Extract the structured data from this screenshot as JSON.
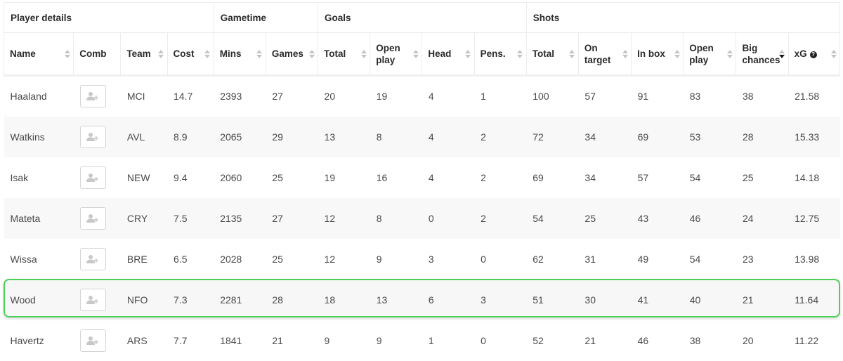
{
  "groups": [
    {
      "label": "Player details",
      "span": 4
    },
    {
      "label": "Gametime",
      "span": 2
    },
    {
      "label": "Goals",
      "span": 4
    },
    {
      "label": "Shots",
      "span": 6
    }
  ],
  "columns": [
    {
      "label": "Name",
      "sortable": true
    },
    {
      "label": "Comb",
      "sortable": false
    },
    {
      "label": "Team",
      "sortable": true
    },
    {
      "label": "Cost",
      "sortable": true
    },
    {
      "label": "Mins",
      "sortable": true
    },
    {
      "label": "Games",
      "sortable": true
    },
    {
      "label": "Total",
      "sortable": true
    },
    {
      "label": "Open play",
      "sortable": true
    },
    {
      "label": "Head",
      "sortable": true
    },
    {
      "label": "Pens.",
      "sortable": true
    },
    {
      "label": "Total",
      "sortable": true
    },
    {
      "label": "On target",
      "sortable": true
    },
    {
      "label": "In box",
      "sortable": true
    },
    {
      "label": "Open play",
      "sortable": true
    },
    {
      "label": "Big chances",
      "sortable": true,
      "sorted": "desc"
    },
    {
      "label": "xG",
      "sortable": true,
      "help_icon": "question-circle-icon"
    }
  ],
  "comb_icon": "add-user-icon",
  "highlight_color": "#4cd05a",
  "highlighted_row": "Wood",
  "rows": [
    {
      "name": "Haaland",
      "team": "MCI",
      "cost": "14.7",
      "mins": "2393",
      "games": "27",
      "goals_total": "20",
      "goals_open": "19",
      "head": "4",
      "pens": "1",
      "shots_total": "100",
      "on_target": "57",
      "in_box": "91",
      "shots_open": "83",
      "big_chances": "38",
      "xg": "21.58"
    },
    {
      "name": "Watkins",
      "team": "AVL",
      "cost": "8.9",
      "mins": "2065",
      "games": "29",
      "goals_total": "13",
      "goals_open": "8",
      "head": "4",
      "pens": "2",
      "shots_total": "72",
      "on_target": "34",
      "in_box": "69",
      "shots_open": "53",
      "big_chances": "28",
      "xg": "15.33"
    },
    {
      "name": "Isak",
      "team": "NEW",
      "cost": "9.4",
      "mins": "2060",
      "games": "25",
      "goals_total": "19",
      "goals_open": "16",
      "head": "4",
      "pens": "2",
      "shots_total": "69",
      "on_target": "34",
      "in_box": "57",
      "shots_open": "54",
      "big_chances": "25",
      "xg": "14.18"
    },
    {
      "name": "Mateta",
      "team": "CRY",
      "cost": "7.5",
      "mins": "2135",
      "games": "27",
      "goals_total": "12",
      "goals_open": "8",
      "head": "0",
      "pens": "2",
      "shots_total": "54",
      "on_target": "25",
      "in_box": "43",
      "shots_open": "46",
      "big_chances": "24",
      "xg": "12.75"
    },
    {
      "name": "Wissa",
      "team": "BRE",
      "cost": "6.5",
      "mins": "2028",
      "games": "25",
      "goals_total": "12",
      "goals_open": "9",
      "head": "3",
      "pens": "0",
      "shots_total": "62",
      "on_target": "31",
      "in_box": "49",
      "shots_open": "54",
      "big_chances": "23",
      "xg": "13.98"
    },
    {
      "name": "Wood",
      "team": "NFO",
      "cost": "7.3",
      "mins": "2281",
      "games": "28",
      "goals_total": "18",
      "goals_open": "13",
      "head": "6",
      "pens": "3",
      "shots_total": "51",
      "on_target": "30",
      "in_box": "41",
      "shots_open": "40",
      "big_chances": "21",
      "xg": "11.64"
    },
    {
      "name": "Havertz",
      "team": "ARS",
      "cost": "7.7",
      "mins": "1841",
      "games": "21",
      "goals_total": "9",
      "goals_open": "9",
      "head": "1",
      "pens": "0",
      "shots_total": "52",
      "on_target": "21",
      "in_box": "46",
      "shots_open": "38",
      "big_chances": "20",
      "xg": "11.22"
    }
  ]
}
